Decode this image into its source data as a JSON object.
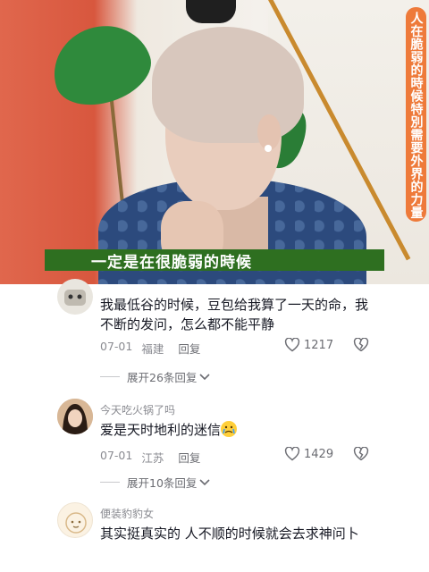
{
  "video": {
    "vertical_banner": "人在脆弱的時候特別需要外界的力量",
    "subtitle": "一定是在很脆弱的時候"
  },
  "comments": [
    {
      "username": "",
      "text": "我最低谷的时候，豆包给我算了一天的命，我不断的发问，怎么都不能平静",
      "date": "07-01",
      "location": "福建",
      "reply_label": "回复",
      "likes": "1217",
      "expand_label": "展开26条回复"
    },
    {
      "username": "今天吃火锅了吗",
      "text": "爱是天时地利的迷信",
      "date": "07-01",
      "location": "江苏",
      "reply_label": "回复",
      "likes": "1429",
      "expand_label": "展开10条回复"
    },
    {
      "username": "便装豹豹女",
      "text": "其实挺真实的 人不顺的时候就会去求神问卜"
    }
  ],
  "colors": {
    "banner_orange": "#ee7a3a",
    "subtitle_green": "#2e6f20",
    "meta_gray": "#8a8b91"
  }
}
